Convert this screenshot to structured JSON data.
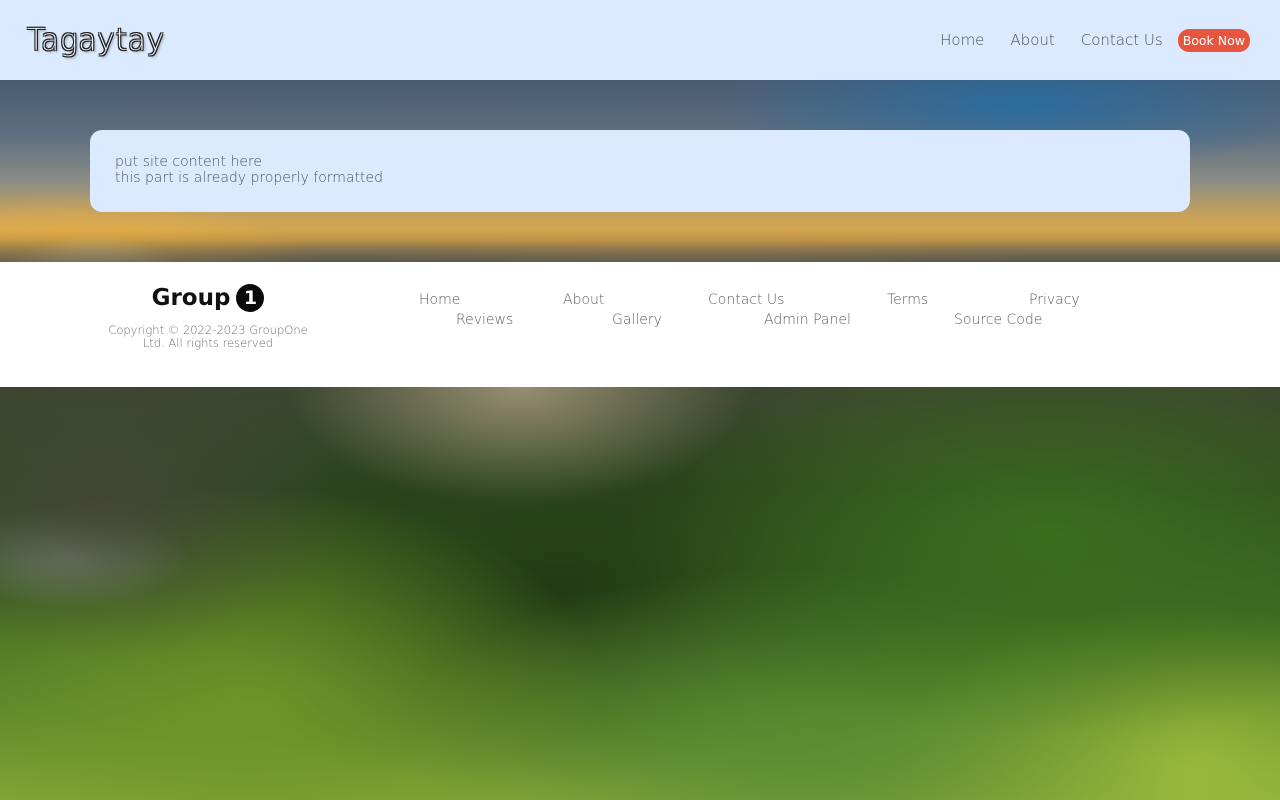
{
  "header": {
    "brand": "Tagaytay",
    "nav": [
      {
        "label": "Home"
      },
      {
        "label": "About"
      },
      {
        "label": "Contact Us"
      }
    ],
    "cta_label": "Book Now"
  },
  "main": {
    "content_lines": [
      "put site content here",
      "this part is already properly formatted"
    ]
  },
  "footer": {
    "logo_text": "Group",
    "logo_badge": "1",
    "copyright_line1": "Copyright © 2022-2023 GroupOne",
    "copyright_line2": "Ltd. All rights reserved",
    "links_row1": [
      "Home",
      "About",
      "Contact Us",
      "Terms",
      "Privacy"
    ],
    "links_row2": [
      "Reviews",
      "Gallery",
      "Admin Panel",
      "Source Code"
    ]
  },
  "colors": {
    "header_bg": "#dbeafe",
    "accent": "#e8553e",
    "footer_bg": "#ffffff"
  }
}
